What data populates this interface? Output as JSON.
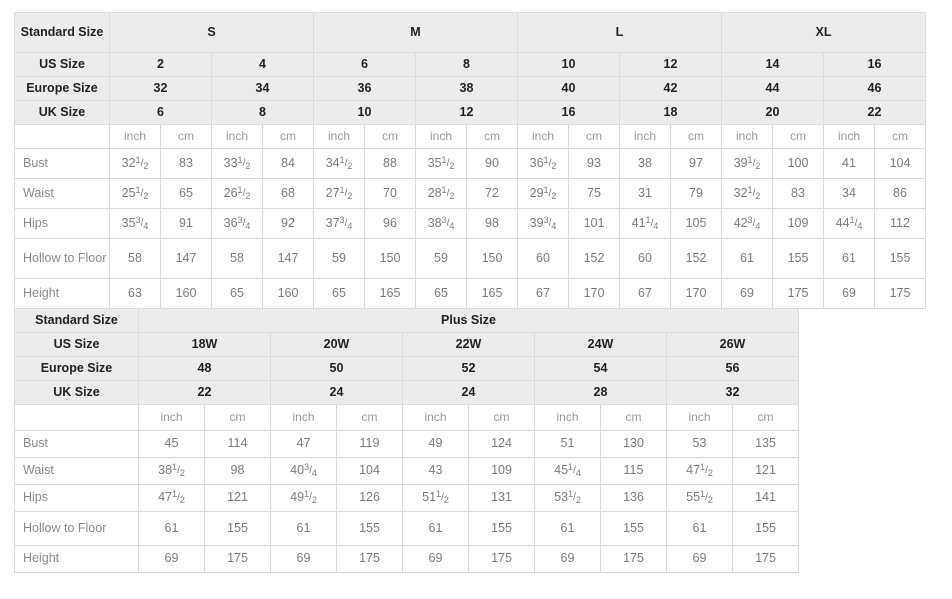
{
  "standard_table": {
    "label_col_header": "Standard Size",
    "size_groups": [
      {
        "label": "S",
        "span": 4
      },
      {
        "label": "M",
        "span": 4
      },
      {
        "label": "L",
        "span": 4
      },
      {
        "label": "XL",
        "span": 4
      }
    ],
    "rows_header": [
      {
        "label": "US Size",
        "values": [
          "2",
          "4",
          "6",
          "8",
          "10",
          "12",
          "14",
          "16"
        ]
      },
      {
        "label": "Europe Size",
        "values": [
          "32",
          "34",
          "36",
          "38",
          "40",
          "42",
          "44",
          "46"
        ]
      },
      {
        "label": "UK Size",
        "values": [
          "6",
          "8",
          "10",
          "12",
          "16",
          "18",
          "20",
          "22"
        ]
      }
    ],
    "units": [
      "inch",
      "cm",
      "inch",
      "cm",
      "inch",
      "cm",
      "inch",
      "cm",
      "inch",
      "cm",
      "inch",
      "cm",
      "inch",
      "cm",
      "inch",
      "cm"
    ],
    "measure_rows": [
      {
        "label": "Bust",
        "values": [
          {
            "w": "32",
            "n": "1",
            "d": "2"
          },
          {
            "w": "83"
          },
          {
            "w": "33",
            "n": "1",
            "d": "2"
          },
          {
            "w": "84"
          },
          {
            "w": "34",
            "n": "1",
            "d": "2"
          },
          {
            "w": "88"
          },
          {
            "w": "35",
            "n": "1",
            "d": "2"
          },
          {
            "w": "90"
          },
          {
            "w": "36",
            "n": "1",
            "d": "2"
          },
          {
            "w": "93"
          },
          {
            "w": "38"
          },
          {
            "w": "97"
          },
          {
            "w": "39",
            "n": "1",
            "d": "2"
          },
          {
            "w": "100"
          },
          {
            "w": "41"
          },
          {
            "w": "104"
          }
        ]
      },
      {
        "label": "Waist",
        "values": [
          {
            "w": "25",
            "n": "1",
            "d": "2"
          },
          {
            "w": "65"
          },
          {
            "w": "26",
            "n": "1",
            "d": "2"
          },
          {
            "w": "68"
          },
          {
            "w": "27",
            "n": "1",
            "d": "2"
          },
          {
            "w": "70"
          },
          {
            "w": "28",
            "n": "1",
            "d": "2"
          },
          {
            "w": "72"
          },
          {
            "w": "29",
            "n": "1",
            "d": "2"
          },
          {
            "w": "75"
          },
          {
            "w": "31"
          },
          {
            "w": "79"
          },
          {
            "w": "32",
            "n": "1",
            "d": "2"
          },
          {
            "w": "83"
          },
          {
            "w": "34"
          },
          {
            "w": "86"
          }
        ]
      },
      {
        "label": "Hips",
        "values": [
          {
            "w": "35",
            "n": "3",
            "d": "4"
          },
          {
            "w": "91"
          },
          {
            "w": "36",
            "n": "3",
            "d": "4"
          },
          {
            "w": "92"
          },
          {
            "w": "37",
            "n": "3",
            "d": "4"
          },
          {
            "w": "96"
          },
          {
            "w": "38",
            "n": "3",
            "d": "4"
          },
          {
            "w": "98"
          },
          {
            "w": "39",
            "n": "3",
            "d": "4"
          },
          {
            "w": "101"
          },
          {
            "w": "41",
            "n": "1",
            "d": "4"
          },
          {
            "w": "105"
          },
          {
            "w": "42",
            "n": "3",
            "d": "4"
          },
          {
            "w": "109"
          },
          {
            "w": "44",
            "n": "1",
            "d": "4"
          },
          {
            "w": "112"
          }
        ]
      },
      {
        "label": "Hollow to Floor",
        "values": [
          {
            "w": "58"
          },
          {
            "w": "147"
          },
          {
            "w": "58"
          },
          {
            "w": "147"
          },
          {
            "w": "59"
          },
          {
            "w": "150"
          },
          {
            "w": "59"
          },
          {
            "w": "150"
          },
          {
            "w": "60"
          },
          {
            "w": "152"
          },
          {
            "w": "60"
          },
          {
            "w": "152"
          },
          {
            "w": "61"
          },
          {
            "w": "155"
          },
          {
            "w": "61"
          },
          {
            "w": "155"
          }
        ]
      },
      {
        "label": "Height",
        "values": [
          {
            "w": "63"
          },
          {
            "w": "160"
          },
          {
            "w": "65"
          },
          {
            "w": "160"
          },
          {
            "w": "65"
          },
          {
            "w": "165"
          },
          {
            "w": "65"
          },
          {
            "w": "165"
          },
          {
            "w": "67"
          },
          {
            "w": "170"
          },
          {
            "w": "67"
          },
          {
            "w": "170"
          },
          {
            "w": "69"
          },
          {
            "w": "175"
          },
          {
            "w": "69"
          },
          {
            "w": "175"
          }
        ]
      }
    ]
  },
  "plus_table": {
    "label_col_header": "Standard Size",
    "group_title": "Plus Size",
    "rows_header": [
      {
        "label": "US Size",
        "values": [
          "18W",
          "20W",
          "22W",
          "24W",
          "26W"
        ]
      },
      {
        "label": "Europe Size",
        "values": [
          "48",
          "50",
          "52",
          "54",
          "56"
        ]
      },
      {
        "label": "UK Size",
        "values": [
          "22",
          "24",
          "24",
          "28",
          "32"
        ]
      }
    ],
    "units": [
      "inch",
      "cm",
      "inch",
      "cm",
      "inch",
      "cm",
      "inch",
      "cm",
      "inch",
      "cm"
    ],
    "measure_rows": [
      {
        "label": "Bust",
        "values": [
          {
            "w": "45"
          },
          {
            "w": "114"
          },
          {
            "w": "47"
          },
          {
            "w": "119"
          },
          {
            "w": "49"
          },
          {
            "w": "124"
          },
          {
            "w": "51"
          },
          {
            "w": "130"
          },
          {
            "w": "53"
          },
          {
            "w": "135"
          }
        ]
      },
      {
        "label": "Waist",
        "values": [
          {
            "w": "38",
            "n": "1",
            "d": "2"
          },
          {
            "w": "98"
          },
          {
            "w": "40",
            "n": "3",
            "d": "4"
          },
          {
            "w": "104"
          },
          {
            "w": "43"
          },
          {
            "w": "109"
          },
          {
            "w": "45",
            "n": "1",
            "d": "4"
          },
          {
            "w": "115"
          },
          {
            "w": "47",
            "n": "1",
            "d": "2"
          },
          {
            "w": "121"
          }
        ]
      },
      {
        "label": "Hips",
        "values": [
          {
            "w": "47",
            "n": "1",
            "d": "2"
          },
          {
            "w": "121"
          },
          {
            "w": "49",
            "n": "1",
            "d": "2"
          },
          {
            "w": "126"
          },
          {
            "w": "51",
            "n": "1",
            "d": "2"
          },
          {
            "w": "131"
          },
          {
            "w": "53",
            "n": "1",
            "d": "2"
          },
          {
            "w": "136"
          },
          {
            "w": "55",
            "n": "1",
            "d": "2"
          },
          {
            "w": "141"
          }
        ]
      },
      {
        "label": "Hollow to Floor",
        "values": [
          {
            "w": "61"
          },
          {
            "w": "155"
          },
          {
            "w": "61"
          },
          {
            "w": "155"
          },
          {
            "w": "61"
          },
          {
            "w": "155"
          },
          {
            "w": "61"
          },
          {
            "w": "155"
          },
          {
            "w": "61"
          },
          {
            "w": "155"
          }
        ]
      },
      {
        "label": "Height",
        "values": [
          {
            "w": "69"
          },
          {
            "w": "175"
          },
          {
            "w": "69"
          },
          {
            "w": "175"
          },
          {
            "w": "69"
          },
          {
            "w": "175"
          },
          {
            "w": "69"
          },
          {
            "w": "175"
          },
          {
            "w": "69"
          },
          {
            "w": "175"
          }
        ]
      }
    ]
  }
}
